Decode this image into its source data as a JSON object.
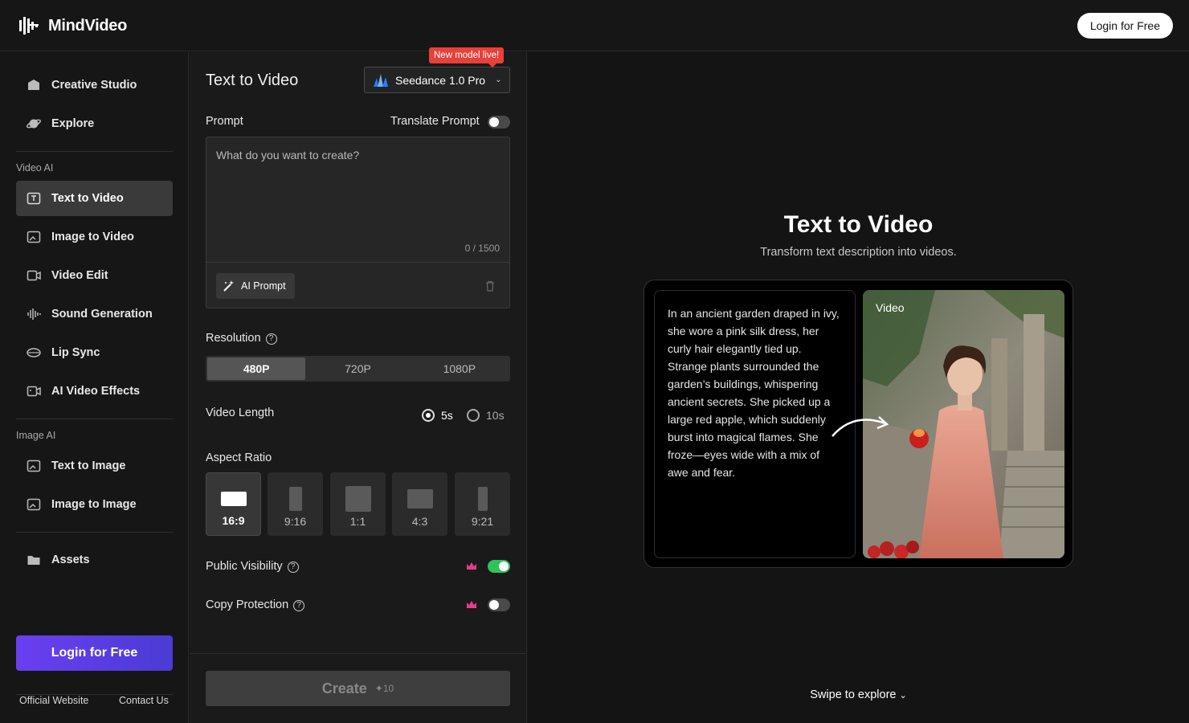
{
  "header": {
    "brand": "MindVideo",
    "login_label": "Login for Free"
  },
  "sidebar": {
    "top_items": [
      {
        "label": "Creative Studio",
        "icon": "studio-icon"
      },
      {
        "label": "Explore",
        "icon": "planet-icon"
      }
    ],
    "video_group_label": "Video AI",
    "video_items": [
      {
        "label": "Text to Video",
        "icon": "text-video-icon",
        "active": true
      },
      {
        "label": "Image to Video",
        "icon": "image-video-icon"
      },
      {
        "label": "Video Edit",
        "icon": "video-edit-icon"
      },
      {
        "label": "Sound Generation",
        "icon": "sound-wave-icon"
      },
      {
        "label": "Lip Sync",
        "icon": "lips-icon"
      },
      {
        "label": "AI Video Effects",
        "icon": "video-effects-icon"
      }
    ],
    "image_group_label": "Image AI",
    "image_items": [
      {
        "label": "Text to Image",
        "icon": "text-image-icon"
      },
      {
        "label": "Image to Image",
        "icon": "image-image-icon"
      }
    ],
    "assets_label": "Assets",
    "login_label": "Login for Free",
    "footer": {
      "official_website": "Official Website",
      "contact_us": "Contact Us"
    }
  },
  "panel": {
    "title": "Text to Video",
    "model": {
      "name": "Seedance 1.0 Pro",
      "badge": "New model live!"
    },
    "prompt": {
      "label": "Prompt",
      "translate_label": "Translate Prompt",
      "translate_on": false,
      "placeholder": "What do you want to create?",
      "value": "",
      "char_count": "0 / 1500",
      "ai_prompt_label": "AI Prompt"
    },
    "resolution": {
      "label": "Resolution",
      "options": [
        "480P",
        "720P",
        "1080P"
      ],
      "selected": "480P"
    },
    "video_length": {
      "label": "Video Length",
      "options": [
        "5s",
        "10s"
      ],
      "selected": "5s"
    },
    "aspect_ratio": {
      "label": "Aspect Ratio",
      "options": [
        "16:9",
        "9:16",
        "1:1",
        "4:3",
        "9:21"
      ],
      "selected": "16:9"
    },
    "public_visibility": {
      "label": "Public Visibility",
      "on": true
    },
    "copy_protection": {
      "label": "Copy Protection",
      "on": false
    },
    "create": {
      "label": "Create",
      "credits": "10"
    }
  },
  "showcase": {
    "title": "Text to Video",
    "subtitle": "Transform text description into videos.",
    "example_text": "In an ancient garden draped in ivy, she wore a pink silk dress, her curly hair elegantly tied up. Strange plants surrounded the garden’s buildings, whispering ancient secrets. She picked up a large red apple, which suddenly burst into magical flames. She froze—eyes wide with a mix of awe and fear.",
    "video_tag": "Video",
    "swipe_label": "Swipe to explore"
  },
  "colors": {
    "accent_gradient_start": "#6a3ff0",
    "accent_gradient_end": "#4b3bd3",
    "toggle_on": "#2fc25b",
    "badge_red": "#e8403a"
  }
}
